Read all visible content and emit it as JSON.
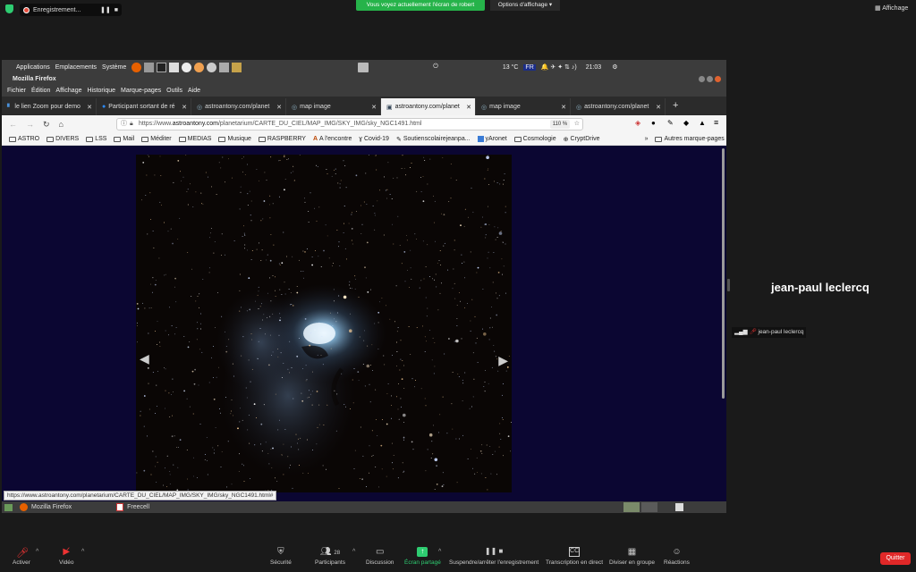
{
  "zoom_top": {
    "recording_label": "Enregistrement...",
    "share_banner": "Vous voyez actuellement l'écran de robert",
    "options_label": "Options d'affichage",
    "view_label": "Affichage"
  },
  "desktop": {
    "panel": {
      "applications": "Applications",
      "places": "Emplacements",
      "system": "Système",
      "temp": "13 °C",
      "lang": "FR",
      "clock": "21:03"
    },
    "firefox": {
      "window_title": "Mozilla Firefox",
      "menu": [
        "Fichier",
        "Édition",
        "Affichage",
        "Historique",
        "Marque-pages",
        "Outils",
        "Aide"
      ],
      "tabs": [
        {
          "label": "le lien Zoom pour demo"
        },
        {
          "label": "Participant sortant de ré"
        },
        {
          "label": "astroantony.com/planet"
        },
        {
          "label": "map image"
        },
        {
          "label": "astroantony.com/planet"
        },
        {
          "label": "map image"
        },
        {
          "label": "astroantony.com/planet"
        }
      ],
      "url_prefix": "https://www.",
      "url_host": "astroantony.com",
      "url_path": "/planetarium/CARTE_DU_CIEL/MAP_IMG/SKY_IMG/sky_NGC1491.html",
      "zoom_level": "110 %",
      "bookmarks": [
        "ASTRO",
        "DIVERS",
        "LSS",
        "Mail",
        "Méditer",
        "MEDIAS",
        "Musique",
        "RASPBERRY",
        "A l'encontre",
        "Covid-19",
        "Soutienscolairejeanpa...",
        "yAronet",
        "Cosmologie",
        "CryptDrive"
      ],
      "other_bookmarks": "Autres marque-pages",
      "status_url": "https://www.astroantony.com/planetarium/CARTE_DU_CIEL/MAP_IMG/SKY_IMG/sky_NGC1491.html#"
    },
    "taskbar": {
      "firefox_label": "Mozilla Firefox",
      "freecell_label": "Freecell"
    }
  },
  "participant": {
    "name_large": "jean-paul leclercq",
    "name_small": "jean-paul leclercq"
  },
  "toolbar": {
    "mute": "Activer",
    "video": "Vidéo",
    "security": "Sécurité",
    "participants": "Participants",
    "participants_count": "28",
    "chat": "Discussion",
    "share": "Écran partagé",
    "record": "Suspendre/arrêter l'enregistrement",
    "transcript": "Transcription en direct",
    "breakout": "Diviser en groupe",
    "reactions": "Réactions",
    "quit": "Quitter"
  }
}
